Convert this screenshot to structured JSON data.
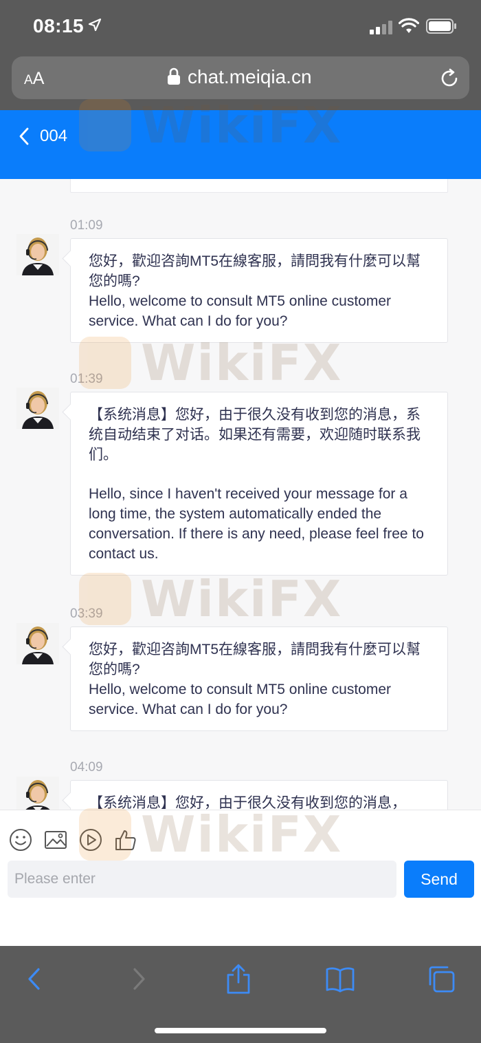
{
  "status_bar": {
    "time": "08:15"
  },
  "browser": {
    "text_size_label_small": "A",
    "text_size_label_large": "A",
    "url": "chat.meiqia.cn"
  },
  "header": {
    "title": "004"
  },
  "messages": [
    {
      "time": "01:09",
      "lines_zh": "您好，歡迎咨詢MT5在線客服，請問我有什麼可以幫您的嗎?",
      "lines_en": "Hello, welcome to consult MT5 online customer service. What can I do for you?"
    },
    {
      "time": "01:39",
      "lines_zh": "【系统消息】您好，由于很久没有收到您的消息，系统自动结束了对话。如果还有需要，欢迎随时联系我们。",
      "lines_en": "Hello, since I haven't received your message for a long time, the system automatically ended the conversation. If there is any need, please feel free to contact us."
    },
    {
      "time": "03:39",
      "lines_zh": "您好，歡迎咨詢MT5在線客服，請問我有什麼可以幫您的嗎?",
      "lines_en": "Hello, welcome to consult MT5 online customer service. What can I do for you?"
    },
    {
      "time": "04:09",
      "lines_zh": "【系统消息】您好，由于很久没有收到您的消息，"
    }
  ],
  "composer": {
    "placeholder": "Please enter",
    "send_label": "Send"
  },
  "watermark": {
    "text": "WikiFX"
  },
  "colors": {
    "accent": "#0a7dfb",
    "chrome": "#5a5a5a",
    "browser_tint": "#3d8bf5"
  },
  "icons": [
    "location-arrow-icon",
    "signal-icon",
    "wifi-icon",
    "battery-icon",
    "lock-icon",
    "reload-icon",
    "back-chevron-icon",
    "emoji-icon",
    "image-icon",
    "video-icon",
    "thumbs-up-icon",
    "safari-back-icon",
    "safari-forward-icon",
    "share-icon",
    "bookmarks-icon",
    "tabs-icon"
  ]
}
